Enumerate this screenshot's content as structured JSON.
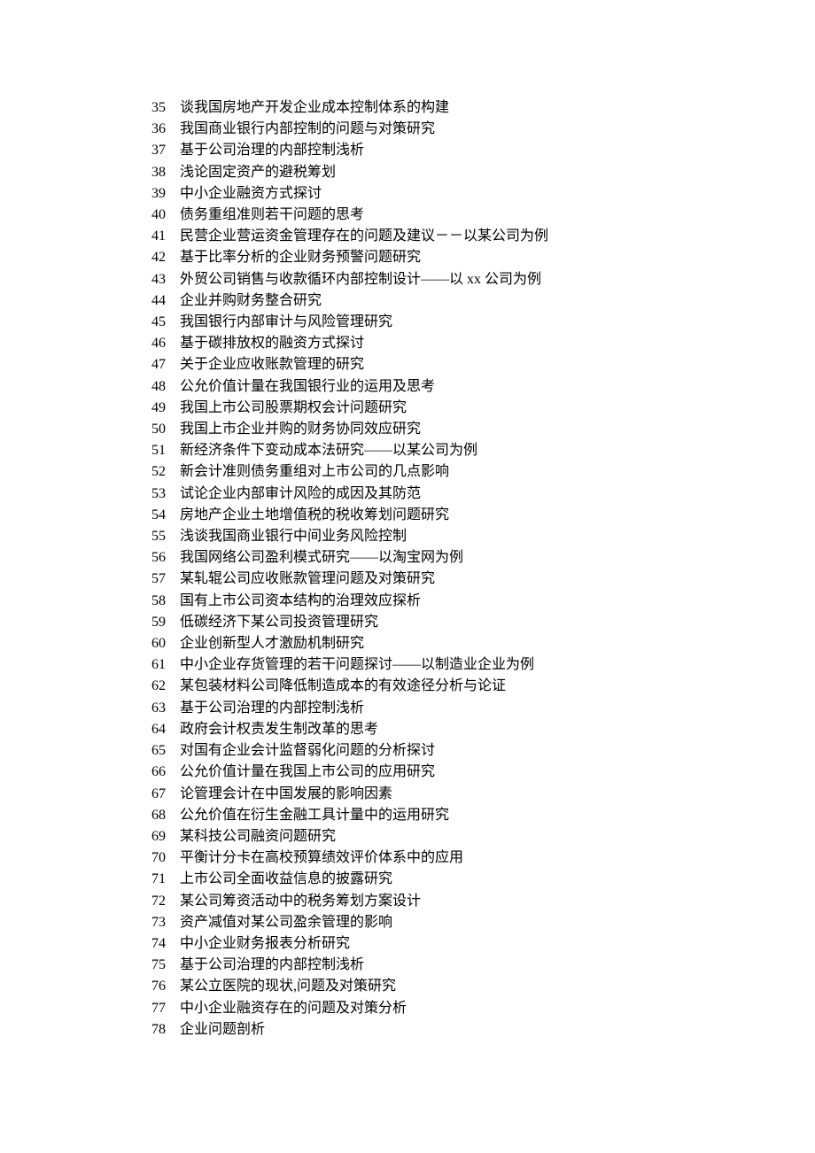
{
  "items": [
    {
      "num": "35",
      "text": "谈我国房地产开发企业成本控制体系的构建"
    },
    {
      "num": "36",
      "text": "我国商业银行内部控制的问题与对策研究"
    },
    {
      "num": "37",
      "text": "基于公司治理的内部控制浅析"
    },
    {
      "num": "38",
      "text": "浅论固定资产的避税筹划"
    },
    {
      "num": "39",
      "text": "中小企业融资方式探讨"
    },
    {
      "num": "40",
      "text": "债务重组准则若干问题的思考"
    },
    {
      "num": "41",
      "text": "民营企业营运资金管理存在的问题及建议－－以某公司为例"
    },
    {
      "num": "42",
      "text": "基于比率分析的企业财务预警问题研究"
    },
    {
      "num": "43",
      "text": "外贸公司销售与收款循环内部控制设计——以 xx 公司为例"
    },
    {
      "num": "44",
      "text": "企业并购财务整合研究"
    },
    {
      "num": "45",
      "text": "我国银行内部审计与风险管理研究"
    },
    {
      "num": "46",
      "text": "基于碳排放权的融资方式探讨"
    },
    {
      "num": "47",
      "text": "关于企业应收账款管理的研究"
    },
    {
      "num": "48",
      "text": "公允价值计量在我国银行业的运用及思考"
    },
    {
      "num": "49",
      "text": "我国上市公司股票期权会计问题研究"
    },
    {
      "num": "50",
      "text": "我国上市企业并购的财务协同效应研究"
    },
    {
      "num": "51",
      "text": "新经济条件下变动成本法研究——以某公司为例"
    },
    {
      "num": "52",
      "text": "新会计准则债务重组对上市公司的几点影响"
    },
    {
      "num": "53",
      "text": "试论企业内部审计风险的成因及其防范"
    },
    {
      "num": "54",
      "text": "房地产企业土地增值税的税收筹划问题研究"
    },
    {
      "num": "55",
      "text": "浅谈我国商业银行中间业务风险控制"
    },
    {
      "num": "56",
      "text": "我国网络公司盈利模式研究——以淘宝网为例"
    },
    {
      "num": "57",
      "text": "某轧辊公司应收账款管理问题及对策研究"
    },
    {
      "num": "58",
      "text": "国有上市公司资本结构的治理效应探析"
    },
    {
      "num": "59",
      "text": "低碳经济下某公司投资管理研究"
    },
    {
      "num": "60",
      "text": "企业创新型人才激励机制研究"
    },
    {
      "num": "61",
      "text": "中小企业存货管理的若干问题探讨——以制造业企业为例"
    },
    {
      "num": "62",
      "text": "某包装材料公司降低制造成本的有效途径分析与论证"
    },
    {
      "num": "63",
      "text": "基于公司治理的内部控制浅析"
    },
    {
      "num": "64",
      "text": "政府会计权责发生制改革的思考"
    },
    {
      "num": "65",
      "text": "对国有企业会计监督弱化问题的分析探讨"
    },
    {
      "num": "66",
      "text": "公允价值计量在我国上市公司的应用研究"
    },
    {
      "num": "67",
      "text": "论管理会计在中国发展的影响因素"
    },
    {
      "num": "68",
      "text": "公允价值在衍生金融工具计量中的运用研究"
    },
    {
      "num": "69",
      "text": "某科技公司融资问题研究"
    },
    {
      "num": "70",
      "text": "平衡计分卡在高校预算绩效评价体系中的应用"
    },
    {
      "num": "71",
      "text": "上市公司全面收益信息的披露研究"
    },
    {
      "num": "72",
      "text": "某公司筹资活动中的税务筹划方案设计"
    },
    {
      "num": "73",
      "text": "资产减值对某公司盈余管理的影响"
    },
    {
      "num": "74",
      "text": "中小企业财务报表分析研究"
    },
    {
      "num": "75",
      "text": "基于公司治理的内部控制浅析"
    },
    {
      "num": "76",
      "text": "某公立医院的现状,问题及对策研究"
    },
    {
      "num": "77",
      "text": "中小企业融资存在的问题及对策分析"
    },
    {
      "num": "78",
      "text": "企业问题剖析"
    }
  ]
}
